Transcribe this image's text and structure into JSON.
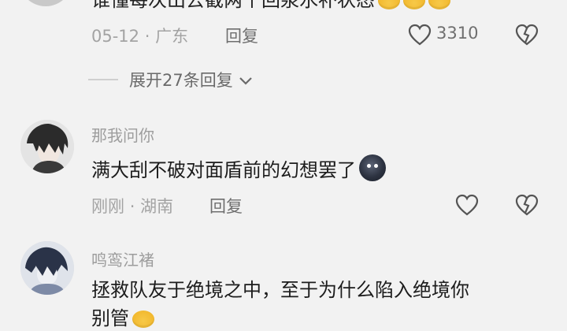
{
  "comment_top": {
    "text": "谁懂每次出去截两个回泉水补状态",
    "emoji": "crying-face-emoji",
    "date": "05-12",
    "location": "广东",
    "reply_label": "回复",
    "like_count": "3310",
    "expand_label": "展开27条回复"
  },
  "comment_1": {
    "username": "那我问你",
    "text": "满大刮不破对面盾前的幻想罢了",
    "emoji": "dark-face-emoji",
    "date": "刚刚",
    "location": "湖南",
    "reply_label": "回复"
  },
  "comment_2": {
    "username": "鸣鸾江褚",
    "text": "拯救队友于绝境之中，至于为什么陷入绝境你",
    "text_line2": "别管"
  },
  "separator": "·"
}
